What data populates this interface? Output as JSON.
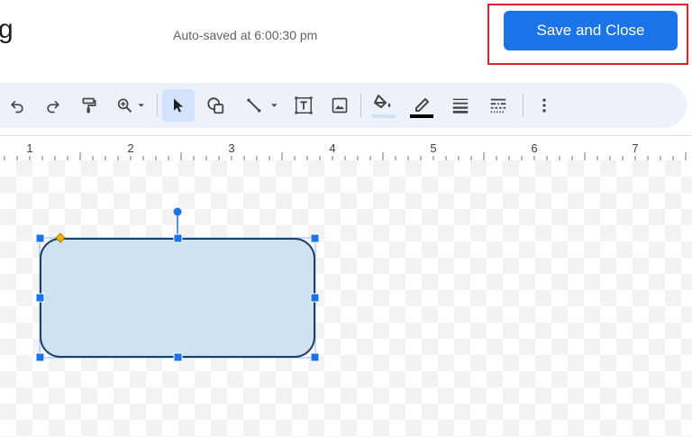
{
  "header": {
    "title_fragment": "g",
    "autosave_text": "Auto-saved at 6:00:30 pm",
    "save_close_label": "Save and Close"
  },
  "toolbar": {
    "icons": [
      "undo-icon",
      "redo-icon",
      "paint-format-icon",
      "zoom-icon",
      "select-icon",
      "shape-icon",
      "line-icon",
      "text-box-icon",
      "image-icon",
      "fill-color-icon",
      "border-color-icon",
      "border-weight-icon",
      "border-dash-icon",
      "more-options-icon"
    ],
    "fill_color_indicator": "#cfe2f3",
    "border_color_indicator": "#000000"
  },
  "ruler": {
    "labels": [
      "1",
      "2",
      "3",
      "4",
      "5",
      "6",
      "7"
    ]
  },
  "shape": {
    "type": "rounded-rectangle",
    "fill": "#cfe2f3",
    "stroke": "#1f3f66",
    "selection_color": "#1a73e8",
    "adjust_handle_color": "#f4b400"
  },
  "colors": {
    "accent": "#1a73e8",
    "highlight": "#e0202a",
    "toolbar_bg": "#edf2fa"
  }
}
